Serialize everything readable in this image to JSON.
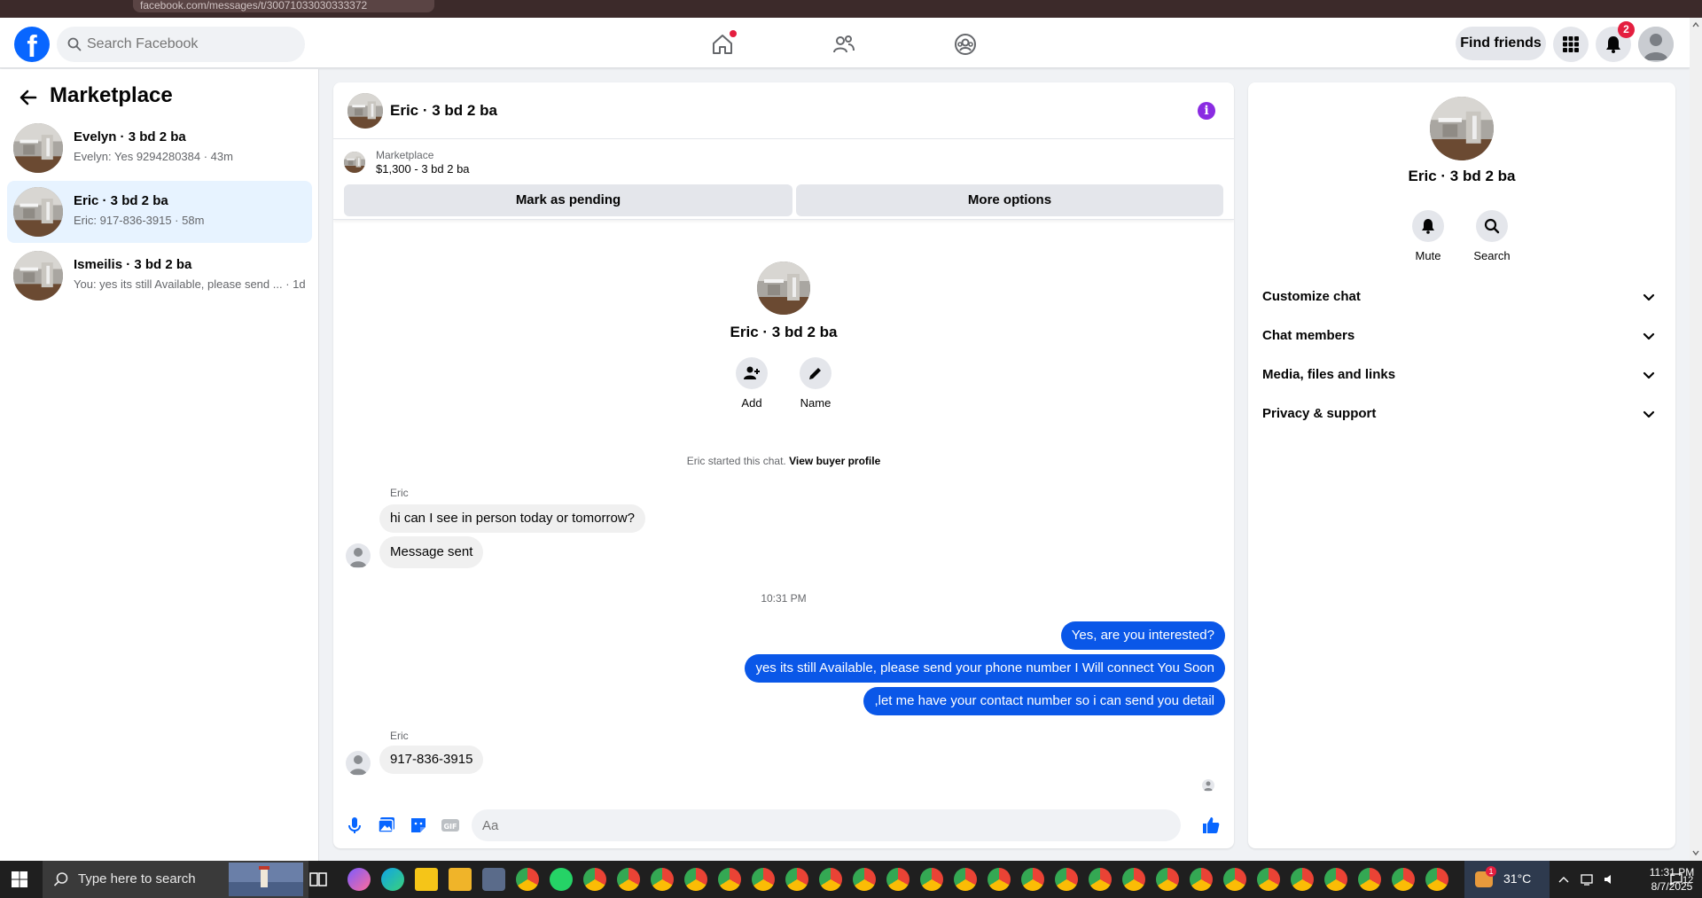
{
  "browser": {
    "url": "facebook.com/messages/t/30071033030333372"
  },
  "header": {
    "logo": "f",
    "search_placeholder": "Search Facebook",
    "find_friends_label": "Find friends",
    "notifications_badge": "2",
    "icons": [
      "home-icon",
      "friends-icon",
      "groups-icon",
      "menu-grid-icon",
      "bell-icon",
      "account-avatar"
    ]
  },
  "sidebar": {
    "title": "Marketplace",
    "conversations": [
      {
        "name": "Evelyn · 3 bd 2 ba",
        "preview": "Evelyn: Yes 9294280384 · 43m",
        "active": false
      },
      {
        "name": "Eric · 3 bd 2 ba",
        "preview": "Eric: 917-836-3915 · 58m",
        "active": true
      },
      {
        "name": "Ismeilis · 3 bd 2 ba",
        "preview": "You: yes its still Available, please send ... · 1d",
        "active": false
      }
    ]
  },
  "chat": {
    "title": "Eric · 3 bd 2 ba",
    "marketplace_label": "Marketplace",
    "listing": "$1,300 - 3 bd 2 ba",
    "mark_pending_label": "Mark as pending",
    "more_options_label": "More options",
    "intro_name": "Eric · 3 bd 2 ba",
    "add_label": "Add",
    "name_label": "Name",
    "started_text": "Eric started this chat.",
    "view_buyer_label": "View buyer profile",
    "sender_name": "Eric",
    "msg_in_1": "hi can I see in person today or tomorrow?",
    "msg_in_2": "Message sent",
    "timestamp": "10:31 PM",
    "msg_out_1": "Yes, are you interested?",
    "msg_out_2": "yes its still Available, please send your phone number I Will connect You Soon",
    "msg_out_3": ",let me have your contact number so i can send you detail",
    "sender_name_2": "Eric",
    "msg_in_3": "917-836-3915",
    "composer_placeholder": "Aa"
  },
  "details": {
    "name": "Eric · 3 bd 2 ba",
    "mute_label": "Mute",
    "search_label": "Search",
    "sections": [
      "Customize chat",
      "Chat members",
      "Media, files and links",
      "Privacy & support"
    ]
  },
  "taskbar": {
    "search_placeholder": "Type here to search",
    "temperature": "31°C",
    "weather_badge": "1",
    "time": "11:31 PM",
    "date": "8/7/2025",
    "notifications_count": "12"
  },
  "colors": {
    "fb_blue": "#0866ff",
    "outgoing_bubble": "#0a57e8",
    "active_conversation": "#e7f3ff",
    "notification_red": "#e41e3f"
  }
}
